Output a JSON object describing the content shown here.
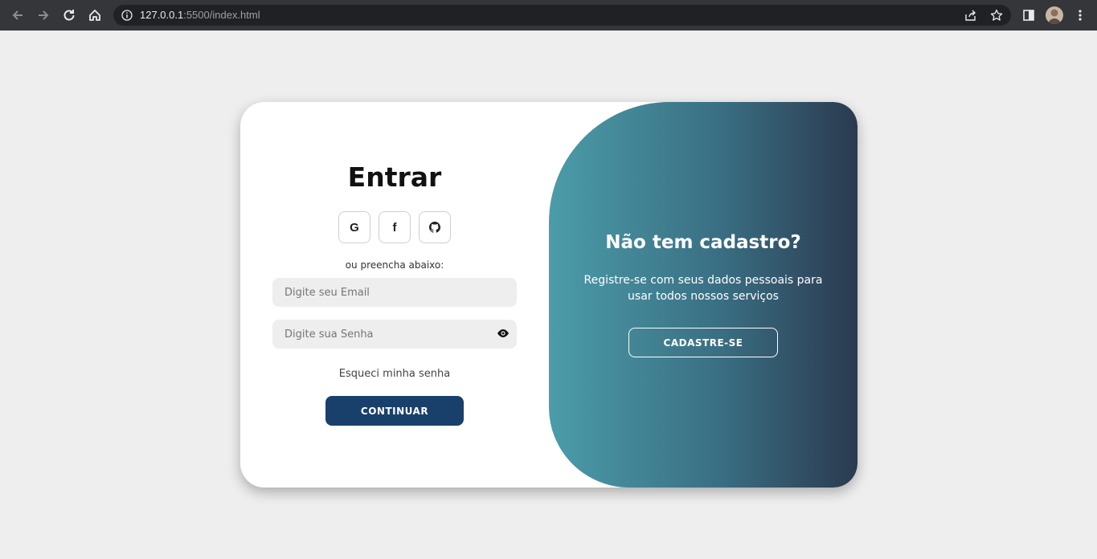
{
  "browser": {
    "url_host": "127.0.0.1",
    "url_rest": ":5500/index.html"
  },
  "login": {
    "title": "Entrar",
    "social": [
      {
        "label": "G",
        "icon": "google-icon"
      },
      {
        "label": "f",
        "icon": "facebook-icon"
      },
      {
        "label": "",
        "icon": "github-icon"
      }
    ],
    "or_text": "ou preencha abaixo:",
    "email_placeholder": "Digite seu Email",
    "email_value": "",
    "password_placeholder": "Digite sua Senha",
    "password_value": "",
    "forgot_label": "Esqueci minha senha",
    "continue_label": "CONTINUAR"
  },
  "signup_panel": {
    "title": "Não tem cadastro?",
    "text": "Registre-se com seus dados pessoais para usar todos nossos serviços",
    "button_label": "CADASTRE-SE"
  },
  "colors": {
    "page_bg": "#eeeeee",
    "primary_button": "#19406a",
    "gradient_start": "#4b9ca9",
    "gradient_end": "#2b3a50"
  }
}
